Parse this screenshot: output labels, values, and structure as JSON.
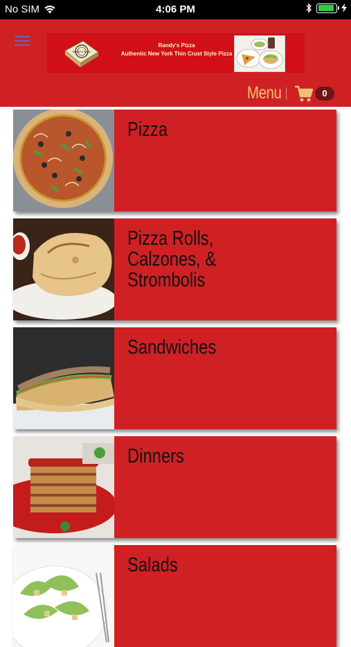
{
  "status_bar": {
    "carrier": "No SIM",
    "time": "4:06 PM"
  },
  "header": {
    "banner": {
      "line1": "Randy's Pizza",
      "line2": "Authentic New York Thin Crust Style Pizza",
      "box_text": "RANDY'S PIZZA"
    },
    "menu_label": "Menu",
    "cart_count": "0"
  },
  "categories": [
    {
      "title": "Pizza"
    },
    {
      "title": "Pizza Rolls,\nCalzones, &\nStrombolis"
    },
    {
      "title": "Sandwiches"
    },
    {
      "title": "Dinners"
    },
    {
      "title": "Salads"
    }
  ],
  "colors": {
    "header_bg": "#cf2124",
    "card_bg": "#cf2124",
    "menu_label": "#f0c07a",
    "cart_badge": "#6e1414"
  }
}
